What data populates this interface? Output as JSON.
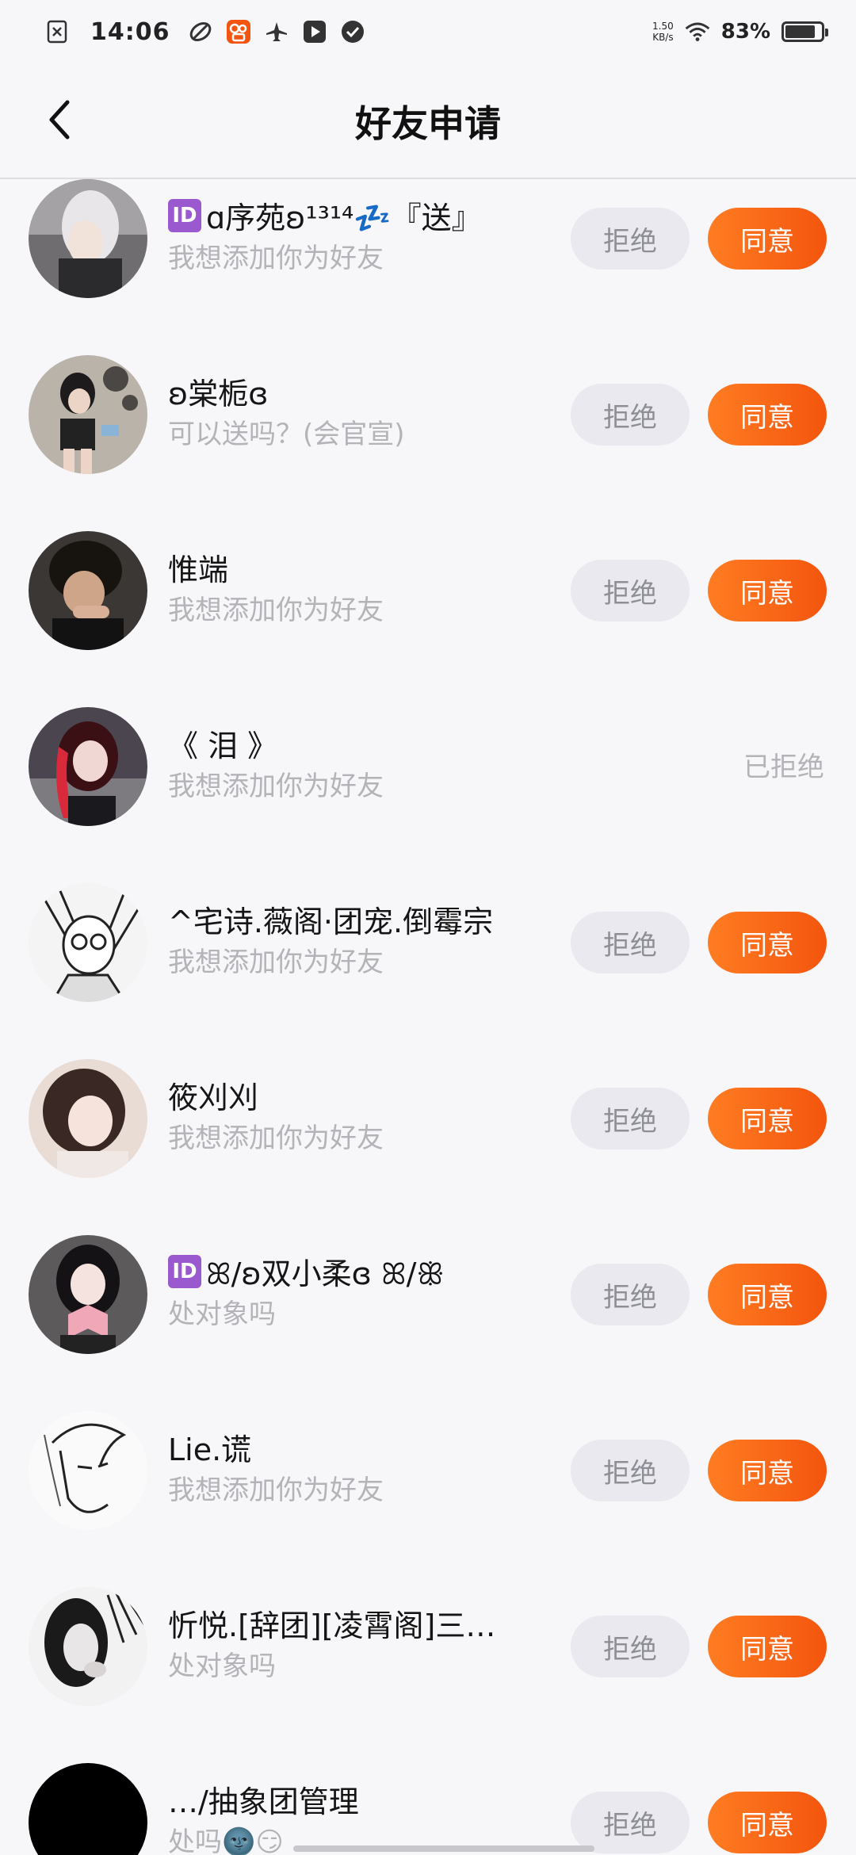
{
  "status_bar": {
    "time": "14:06",
    "net_speed_value": "1.50",
    "net_speed_unit": "KB/s",
    "battery_text": "83%",
    "battery_level": 0.83
  },
  "header": {
    "title": "好友申请"
  },
  "requests": [
    {
      "name": "ɑ序苑ʚ¹³¹⁴💤『送』",
      "id_badge": "ID",
      "message": "我想添加你为好友",
      "reject_label": "拒绝",
      "accept_label": "同意",
      "status": ""
    },
    {
      "name": "ʚ棠栀ɞ",
      "id_badge": "",
      "message": "可以送吗？(会官宣)",
      "reject_label": "拒绝",
      "accept_label": "同意",
      "status": ""
    },
    {
      "name": "惟端",
      "id_badge": "",
      "message": "我想添加你为好友",
      "reject_label": "拒绝",
      "accept_label": "同意",
      "status": ""
    },
    {
      "name": "《 泪 》",
      "id_badge": "",
      "message": "我想添加你为好友",
      "reject_label": "",
      "accept_label": "",
      "status": "已拒绝"
    },
    {
      "name": "^宅诗.薇阁·团宠.倒霉宗",
      "id_badge": "",
      "message": "我想添加你为好友",
      "reject_label": "拒绝",
      "accept_label": "同意",
      "status": ""
    },
    {
      "name": "筱刈刈",
      "id_badge": "",
      "message": "我想添加你为好友",
      "reject_label": "拒绝",
      "accept_label": "同意",
      "status": ""
    },
    {
      "name": "ꕤ/ʚ双小柔ɞ ꕤ/ꕥ",
      "id_badge": "ID",
      "message": "处对象吗",
      "reject_label": "拒绝",
      "accept_label": "同意",
      "status": ""
    },
    {
      "name": "Lie.谎",
      "id_badge": "",
      "message": "我想添加你为好友",
      "reject_label": "拒绝",
      "accept_label": "同意",
      "status": ""
    },
    {
      "name": "忻悦.[辞团][凌霄阁]三…",
      "id_badge": "",
      "message": "处对象吗",
      "reject_label": "拒绝",
      "accept_label": "同意",
      "status": ""
    },
    {
      "name": "…/抽象团管理",
      "id_badge": "",
      "message": "处吗🌚😏",
      "reject_label": "拒绝",
      "accept_label": "同意",
      "status": ""
    }
  ],
  "colors": {
    "accent": "#f3550e",
    "reject_bg": "#e9e9ef",
    "muted_text": "#b3b3b8",
    "background": "#f7f6f9"
  }
}
